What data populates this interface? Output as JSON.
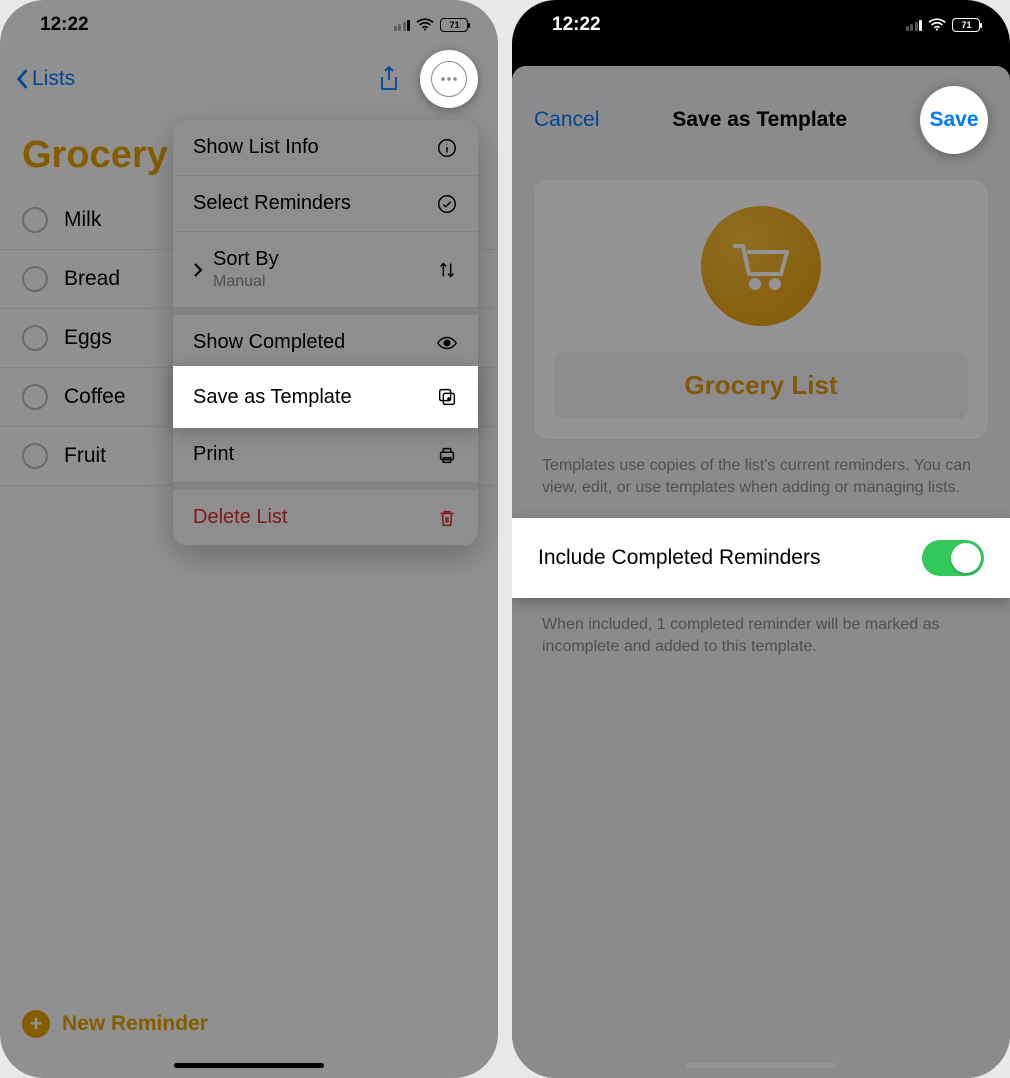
{
  "status": {
    "time": "12:22",
    "battery": "71"
  },
  "left": {
    "back_label": "Lists",
    "title": "Grocery",
    "items": [
      "Milk",
      "Bread",
      "Eggs",
      "Coffee",
      "Fruit"
    ],
    "new_reminder": "New Reminder",
    "menu": {
      "show_info": "Show List Info",
      "select": "Select Reminders",
      "sort": "Sort By",
      "sort_value": "Manual",
      "show_completed": "Show Completed",
      "save_template": "Save as Template",
      "print": "Print",
      "delete": "Delete List"
    }
  },
  "right": {
    "cancel": "Cancel",
    "title": "Save as Template",
    "save": "Save",
    "template_name": "Grocery List",
    "helper": "Templates use copies of the list's current reminders. You can view, edit, or use templates when adding or managing lists.",
    "toggle_label": "Include Completed Reminders",
    "toggle_footer": "When included, 1 completed reminder will be marked as incomplete and added to this template."
  }
}
